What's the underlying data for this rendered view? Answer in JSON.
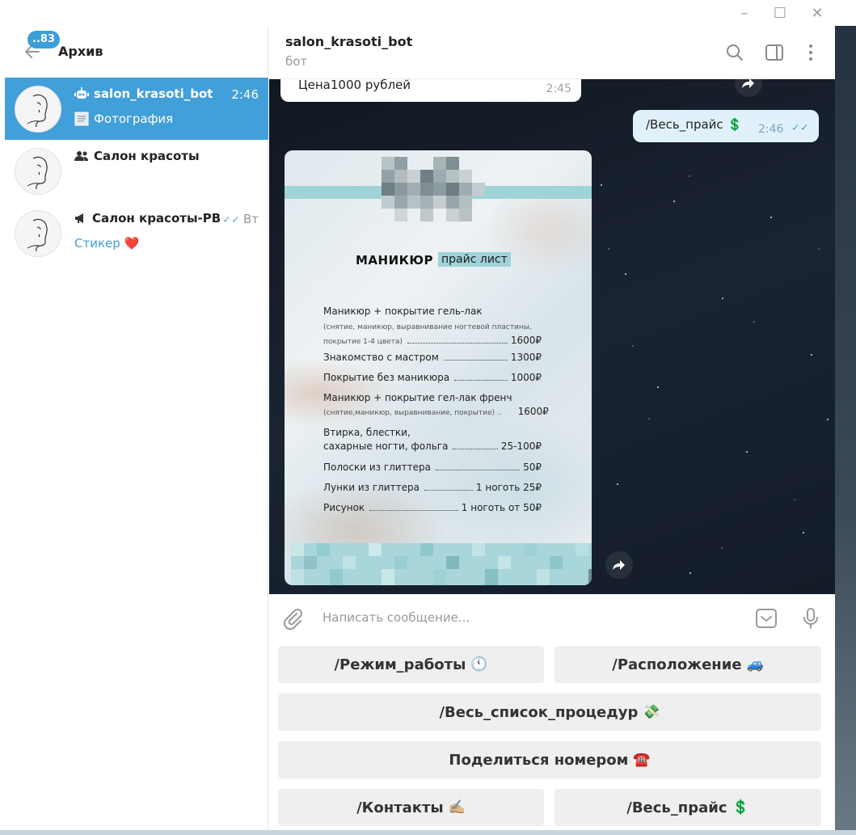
{
  "window": {
    "minimize": "–",
    "maximize": "☐",
    "close": "✕"
  },
  "sidebar": {
    "unread_badge": "..83",
    "title": "Архив",
    "chats": [
      {
        "name": "salon_krasoti_bot",
        "time": "2:46",
        "preview": "Фотография",
        "type_icon": "bot-icon",
        "active": true
      },
      {
        "name": "Салон красоты",
        "time": "",
        "preview": "",
        "type_icon": "group-icon",
        "active": false
      },
      {
        "name": "Салон красоты-РВ",
        "time": "Вт",
        "preview": "Стикер ❤️",
        "type_icon": "channel-icon",
        "active": false
      }
    ]
  },
  "header": {
    "title": "salon_krasoti_bot",
    "subtitle": "бот"
  },
  "messages": {
    "incoming_text": "Цена1000 рублей",
    "incoming_time": "2:45",
    "outgoing_text": "/Весь_прайс 💲",
    "outgoing_time": "2:46"
  },
  "price_list": {
    "title": "МАНИКЮР",
    "subtitle": "прайс лист",
    "items": [
      {
        "name": "Маникюр + покрытие гель-лак",
        "note": "(снятие, маникюр, выравнивание ногтевой пластины,",
        "note2": "покрытие 1-4 цвета)",
        "price": "1600₽"
      },
      {
        "name": "Знакомство с мастром",
        "price": "1300₽"
      },
      {
        "name": "Покрытие без маникюра",
        "price": "1000₽"
      },
      {
        "name": "Маникюр + покрытие гел-лак френч",
        "note": "(снятие,маникюр, выравнивание, покрытие) ..",
        "price": "1600₽"
      },
      {
        "name": "Втирка, блестки,",
        "name2": "сахарные ногти, фольга",
        "price": "25-100₽"
      },
      {
        "name": "Полоски из глиттера",
        "price": "50₽"
      },
      {
        "name": "Лунки из глиттера",
        "price": "1 ноготь 25₽"
      },
      {
        "name": "Рисунок",
        "price": "1 ноготь от 50₽"
      }
    ]
  },
  "composer": {
    "placeholder": "Написать сообщение..."
  },
  "keyboard": {
    "work_mode": "/Режим_работы",
    "work_mode_emoji": "🕚",
    "location": "/Расположение",
    "location_emoji": "🚙",
    "all_procedures": "/Весь_список_процедур",
    "all_procedures_emoji": "💸",
    "share_phone": "Поделиться номером",
    "share_phone_emoji": "☎️",
    "contacts": "/Контакты",
    "contacts_emoji": "✍🏼",
    "full_price": "/Весь_прайс",
    "full_price_emoji": "💲"
  },
  "colors": {
    "accent": "#419fd9",
    "out_bubble": "#e1f1fb",
    "teal": "#9fd3d8"
  }
}
